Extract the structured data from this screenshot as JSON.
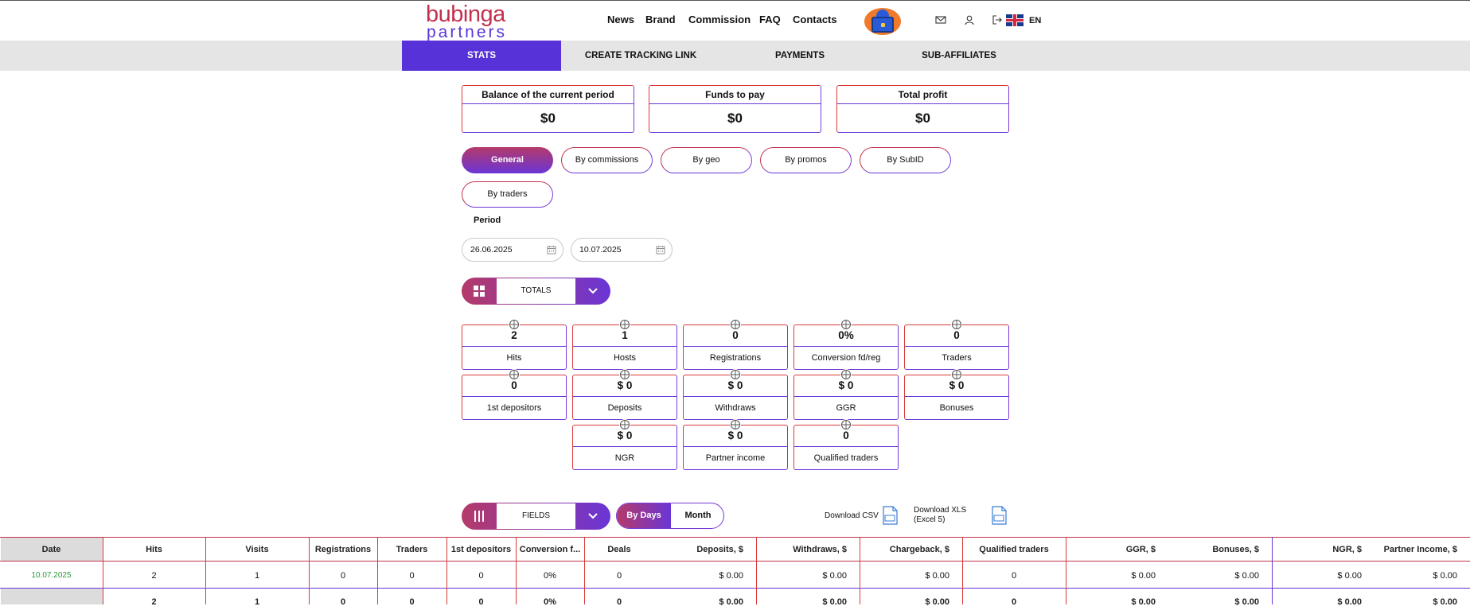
{
  "header": {
    "logo_line1": "bubinga",
    "logo_line2": "partners",
    "nav": [
      "News",
      "Brand",
      "Commission",
      "FAQ",
      "Contacts"
    ],
    "language": "EN"
  },
  "tabs": [
    "STATS",
    "CREATE TRACKING LINK",
    "PAYMENTS",
    "SUB-AFFILIATES"
  ],
  "balances": [
    {
      "title": "Balance of the current period",
      "value": "$0"
    },
    {
      "title": "Funds to pay",
      "value": "$0"
    },
    {
      "title": "Total profit",
      "value": "$0"
    }
  ],
  "filters": [
    "General",
    "By commissions",
    "By geo",
    "By promos",
    "By SubID",
    "By traders"
  ],
  "period": {
    "label": "Period",
    "from": "26.06.2025",
    "to": "10.07.2025"
  },
  "totals_selector": {
    "label": "TOTALS"
  },
  "stats": [
    {
      "value": "2",
      "label": "Hits"
    },
    {
      "value": "1",
      "label": "Hosts"
    },
    {
      "value": "0",
      "label": "Registrations"
    },
    {
      "value": "0%",
      "label": "Conversion fd/reg"
    },
    {
      "value": "0",
      "label": "Traders"
    },
    {
      "value": "0",
      "label": "1st depositors"
    },
    {
      "value": "$ 0",
      "label": "Deposits"
    },
    {
      "value": "$ 0",
      "label": "Withdraws"
    },
    {
      "value": "$ 0",
      "label": "GGR"
    },
    {
      "value": "$ 0",
      "label": "Bonuses"
    },
    {
      "value": "$ 0",
      "label": "NGR"
    },
    {
      "value": "$ 0",
      "label": "Partner income"
    },
    {
      "value": "0",
      "label": "Qualified traders"
    }
  ],
  "fields_selector": {
    "label": "FIELDS"
  },
  "grouping": {
    "by_days": "By Days",
    "month": "Month"
  },
  "downloads": {
    "csv": "Download CSV",
    "xls_line1": "Download XLS",
    "xls_line2": "(Excel 5)"
  },
  "table": {
    "columns": [
      "Date",
      "Hits",
      "Visits",
      "Registrations",
      "Traders",
      "1st depositors",
      "Conversion f...",
      "Deals",
      "Deposits, $",
      "Withdraws, $",
      "Chargeback, $",
      "Qualified traders",
      "GGR, $",
      "Bonuses, $",
      "NGR, $",
      "Partner Income, $"
    ],
    "rows": [
      [
        "10.07.2025",
        "2",
        "1",
        "0",
        "0",
        "0",
        "0%",
        "0",
        "$ 0.00",
        "$ 0.00",
        "$ 0.00",
        "0",
        "$ 0.00",
        "$ 0.00",
        "$ 0.00",
        "$ 0.00"
      ]
    ],
    "totals": [
      "",
      "2",
      "1",
      "0",
      "0",
      "0",
      "0%",
      "0",
      "$ 0.00",
      "$ 0.00",
      "$ 0.00",
      "0",
      "$ 0.00",
      "$ 0.00",
      "$ 0.00",
      "$ 0.00"
    ]
  },
  "colors": {
    "accent": "#5632d8",
    "brand_red": "#c2314e",
    "date_green": "#2c9a3c"
  }
}
